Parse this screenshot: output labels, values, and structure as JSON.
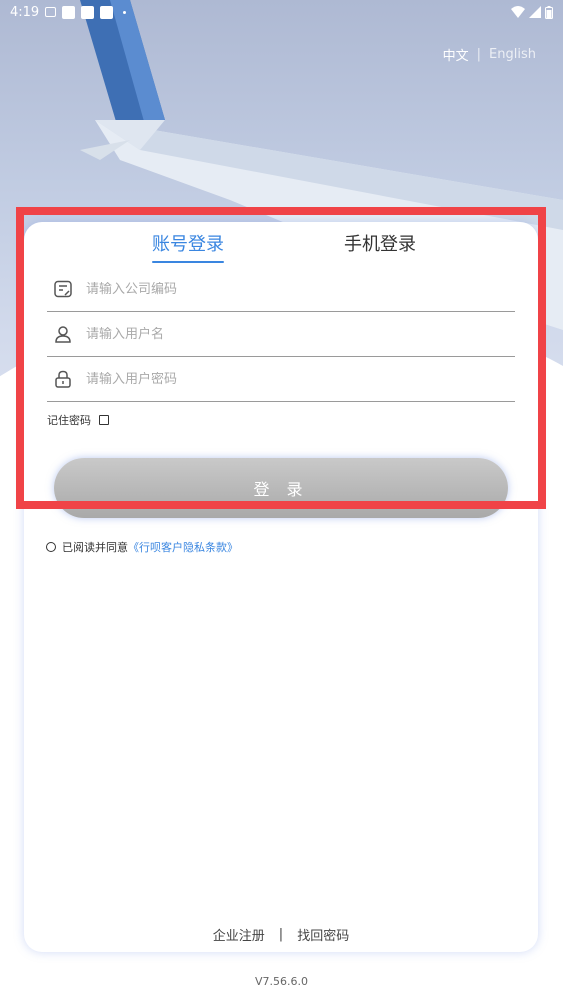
{
  "status_bar": {
    "time": "4:19"
  },
  "language": {
    "chinese": "中文",
    "separator": "|",
    "english": "English"
  },
  "tabs": {
    "account_login": "账号登录",
    "phone_login": "手机登录"
  },
  "fields": {
    "company_code_placeholder": "请输入公司编码",
    "username_placeholder": "请输入用户名",
    "password_placeholder": "请输入用户密码"
  },
  "remember_password": "记住密码",
  "login_button": "登 录",
  "agreement": {
    "prefix": "已阅读并同意",
    "link": "《行呗客户隐私条款》"
  },
  "footer": {
    "register": "企业注册",
    "separator": "|",
    "retrieve_password": "找回密码"
  },
  "version": "V7.56.6.0",
  "colors": {
    "accent": "#3a86e0",
    "highlight": "#f04347"
  },
  "icons": {
    "company": "document-edit-icon",
    "user": "user-icon",
    "password": "lock-icon"
  }
}
